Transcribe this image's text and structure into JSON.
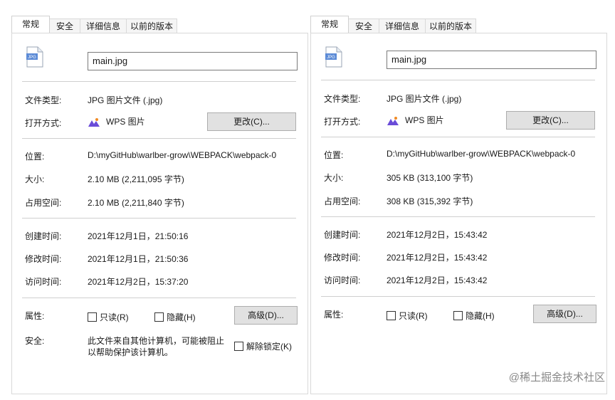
{
  "left": {
    "tabs": [
      "常规",
      "安全",
      "详细信息",
      "以前的版本"
    ],
    "file_name": "main.jpg",
    "file_type_label": "文件类型:",
    "file_type_value": "JPG 图片文件 (.jpg)",
    "open_with_label": "打开方式:",
    "open_with_value": "WPS 图片",
    "change_button": "更改(C)...",
    "location_label": "位置:",
    "location_value": "D:\\myGitHub\\warlber-grow\\WEBPACK\\webpack-0",
    "size_label": "大小:",
    "size_value": "2.10 MB (2,211,095 字节)",
    "disk_label": "占用空间:",
    "disk_value": "2.10 MB (2,211,840 字节)",
    "created_label": "创建时间:",
    "created_value": "2021年12月1日，21:50:16",
    "modified_label": "修改时间:",
    "modified_value": "2021年12月1日，21:50:36",
    "accessed_label": "访问时间:",
    "accessed_value": "2021年12月2日，15:37:20",
    "attributes_label": "属性:",
    "readonly": "只读(R)",
    "hidden": "隐藏(H)",
    "advanced_button": "高级(D)...",
    "security_label": "安全:",
    "security_text_line1": "此文件来自其他计算机，可能被阻止",
    "security_text_line2": "以帮助保护该计算机。",
    "unblock": "解除锁定(K)"
  },
  "right": {
    "tabs": [
      "常规",
      "安全",
      "详细信息",
      "以前的版本"
    ],
    "file_name": "main.jpg",
    "file_type_label": "文件类型:",
    "file_type_value": "JPG 图片文件 (.jpg)",
    "open_with_label": "打开方式:",
    "open_with_value": "WPS 图片",
    "change_button": "更改(C)...",
    "location_label": "位置:",
    "location_value": "D:\\myGitHub\\warlber-grow\\WEBPACK\\webpack-0",
    "size_label": "大小:",
    "size_value": "305 KB (313,100 字节)",
    "disk_label": "占用空间:",
    "disk_value": "308 KB (315,392 字节)",
    "created_label": "创建时间:",
    "created_value": "2021年12月2日，15:43:42",
    "modified_label": "修改时间:",
    "modified_value": "2021年12月2日，15:43:42",
    "accessed_label": "访问时间:",
    "accessed_value": "2021年12月2日，15:43:42",
    "attributes_label": "属性:",
    "readonly": "只读(R)",
    "hidden": "隐藏(H)",
    "advanced_button": "高级(D)..."
  },
  "watermark": "@稀土掘金技术社区",
  "icons": {
    "file": "jpg-file-icon",
    "app": "wps-picture-icon"
  }
}
